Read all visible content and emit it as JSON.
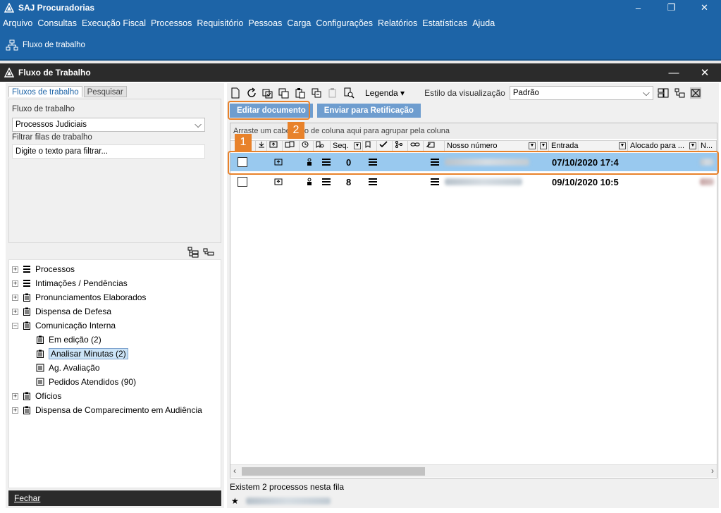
{
  "app": {
    "title": "SAJ Procuradorias"
  },
  "window_controls": {
    "minimize": "–",
    "restore": "❐",
    "close": "✕"
  },
  "menu": [
    "Arquivo",
    "Consultas",
    "Execução Fiscal",
    "Processos",
    "Requisitório",
    "Pessoas",
    "Carga",
    "Configurações",
    "Relatórios",
    "Estatísticas",
    "Ajuda"
  ],
  "ribbon": {
    "label": "Fluxo de trabalho"
  },
  "child_window": {
    "title": "Fluxo de Trabalho",
    "minimize": "—",
    "close": "✕"
  },
  "left": {
    "tabs": [
      "Fluxos de trabalho",
      "Pesquisar"
    ],
    "flow_label": "Fluxo de trabalho",
    "flow_value": "Processos Judiciais",
    "filter_label": "Filtrar filas de trabalho",
    "filter_placeholder": "Digite o texto para filtrar...",
    "tree": [
      {
        "label": "Processos",
        "expander": "+"
      },
      {
        "label": "Intimações / Pendências",
        "expander": "+"
      },
      {
        "label": "Pronunciamentos Elaborados",
        "expander": "+"
      },
      {
        "label": "Dispensa de Defesa",
        "expander": "+"
      },
      {
        "label": "Comunicação Interna",
        "expander": "−"
      },
      {
        "label": "Em edição (2)"
      },
      {
        "label": "Analisar Minutas (2)"
      },
      {
        "label": "Ag. Avaliação"
      },
      {
        "label": "Pedidos Atendidos (90)"
      },
      {
        "label": "Ofícios",
        "expander": "+"
      },
      {
        "label": "Dispensa de Comparecimento em Audiência",
        "expander": "+"
      }
    ],
    "close_button": "Fechar"
  },
  "toolbar": {
    "legend_label": "Legenda",
    "style_label": "Estilo da visualização",
    "style_value": "Padrão"
  },
  "actions": {
    "edit": "Editar documento",
    "send": "Enviar para Retificação"
  },
  "grid": {
    "group_hint": "Arraste um cabeçalho de coluna aqui para agrupar pela coluna",
    "headers": {
      "seq": "Seq.",
      "nosso_numero": "Nosso número",
      "entrada": "Entrada",
      "alocado": "Alocado para ...",
      "n": "N..."
    },
    "rows": [
      {
        "seq": "0",
        "entrada": "07/10/2020 17:4"
      },
      {
        "seq": "8",
        "entrada": "09/10/2020 10:5"
      }
    ]
  },
  "status": {
    "count_text": "Existem 2 processos nesta fila"
  },
  "callouts": {
    "one": "1",
    "two": "2"
  },
  "colors": {
    "brand": "#1d64a7",
    "accent": "#e8822b",
    "dark": "#2b2b2b",
    "selection": "#99c9ef"
  }
}
